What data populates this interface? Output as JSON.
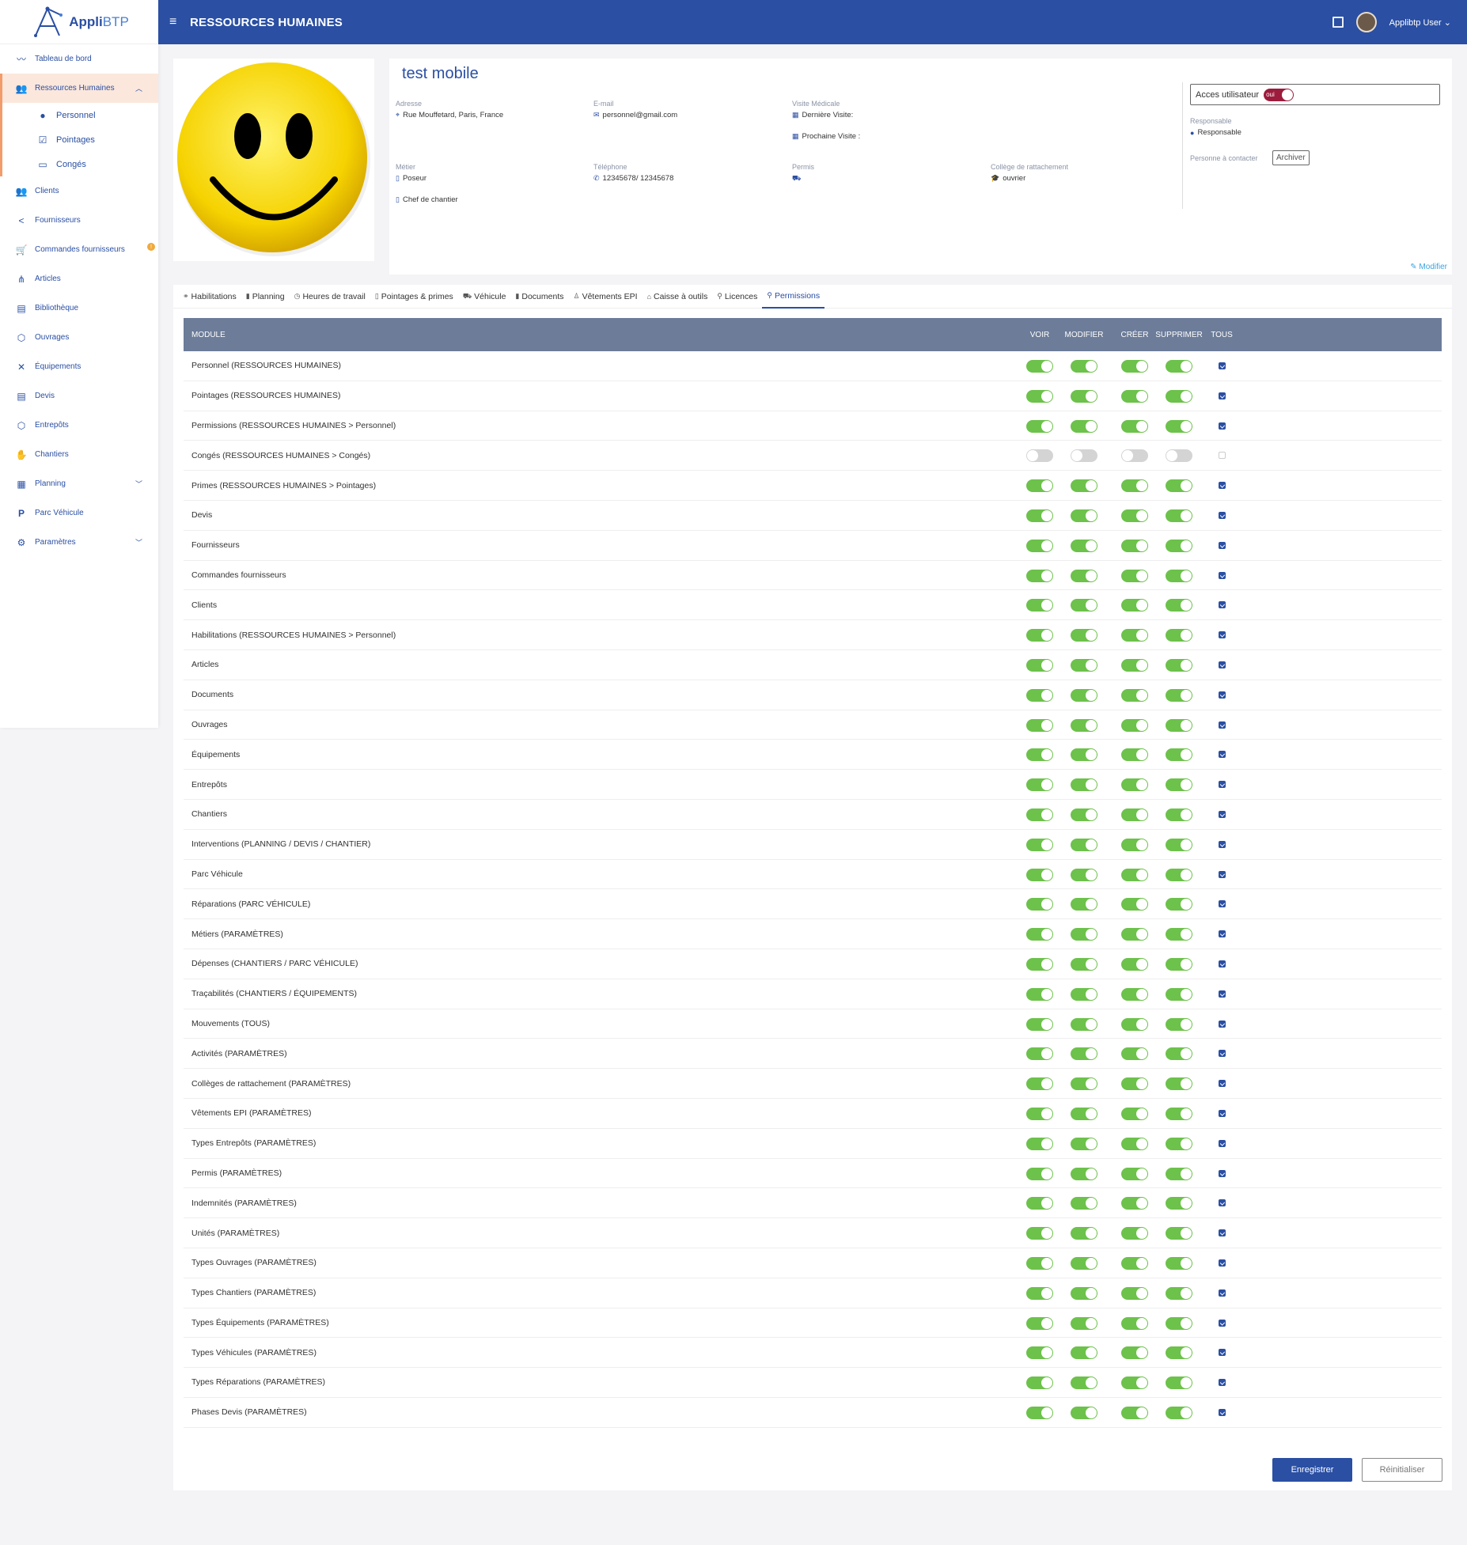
{
  "brand": {
    "name": "Appli",
    "name_suffix": "BTP"
  },
  "topbar": {
    "title": "RESSOURCES HUMAINES",
    "user": "Applibtp User"
  },
  "sidebar": {
    "items": [
      {
        "label": "Tableau de bord",
        "icon": "chart-line-icon"
      },
      {
        "label": "Ressources Humaines",
        "icon": "users-icon",
        "active": true
      },
      {
        "label": "Personnel",
        "icon": "person-icon"
      },
      {
        "label": "Pointages",
        "icon": "clipboard-check-icon"
      },
      {
        "label": "Congés",
        "icon": "id-card-icon"
      },
      {
        "label": "Clients",
        "icon": "users-icon"
      },
      {
        "label": "Fournisseurs",
        "icon": "share-icon"
      },
      {
        "label": "Commandes fournisseurs",
        "icon": "cart-icon"
      },
      {
        "label": "Articles",
        "icon": "sitemap-icon"
      },
      {
        "label": "Bibliothèque",
        "icon": "book-icon"
      },
      {
        "label": "Ouvrages",
        "icon": "cube-icon"
      },
      {
        "label": "Équipements",
        "icon": "tools-icon"
      },
      {
        "label": "Devis",
        "icon": "document-icon"
      },
      {
        "label": "Entrepôts",
        "icon": "box-icon"
      },
      {
        "label": "Chantiers",
        "icon": "handshake-icon"
      },
      {
        "label": "Planning",
        "icon": "calendar-icon"
      },
      {
        "label": "Parc Véhicule",
        "icon": "parking-icon"
      },
      {
        "label": "Paramètres",
        "icon": "gear-icon"
      }
    ],
    "badge": "!"
  },
  "profile": {
    "name": "test mobile",
    "address_label": "Adresse",
    "address": "Rue Mouffetard, Paris, France",
    "email_label": "E-mail",
    "email": "personnel@gmail.com",
    "visite_label": "Visite Médicale",
    "derniere_visite": "Dernière Visite:",
    "prochaine_visite": "Prochaine Visite :",
    "metier_label": "Métier",
    "metier": "Poseur",
    "metier2": "Chef de chantier",
    "telephone_label": "Téléphone",
    "telephone": "12345678/ 12345678",
    "permis_label": "Permis",
    "college_label": "Collège de rattachement",
    "college": "ouvrier",
    "access_label": "Acces utilisateur",
    "access_value": "oui",
    "responsable_label": "Responsable",
    "responsable": "Responsable",
    "contact_label": "Personne à contacter",
    "archiver": "Archiver",
    "modifier": "Modifier"
  },
  "tabs": [
    {
      "label": "Habilitations",
      "icon": "link-icon"
    },
    {
      "label": "Planning",
      "icon": "document-icon"
    },
    {
      "label": "Heures de travail",
      "icon": "clock-icon"
    },
    {
      "label": "Pointages & primes",
      "icon": "document-icon"
    },
    {
      "label": "Véhicule",
      "icon": "car-icon"
    },
    {
      "label": "Documents",
      "icon": "document-icon"
    },
    {
      "label": "Vêtements EPI",
      "icon": "person-icon"
    },
    {
      "label": "Caisse à outils",
      "icon": "toolbox-icon"
    },
    {
      "label": "Licences",
      "icon": "person-key-icon"
    },
    {
      "label": "Permissions",
      "icon": "person-key-icon",
      "active": true
    }
  ],
  "table": {
    "headers": {
      "module": "MODULE",
      "voir": "VOIR",
      "modifier": "MODIFIER",
      "creer": "CRÉER",
      "supprimer": "SUPPRIMER",
      "tous": "TOUS"
    },
    "rows": [
      {
        "module": "Personnel (RESSOURCES HUMAINES)",
        "on": true
      },
      {
        "module": "Pointages (RESSOURCES HUMAINES)",
        "on": true
      },
      {
        "module": "Permissions (RESSOURCES HUMAINES > Personnel)",
        "on": true
      },
      {
        "module": "Congés (RESSOURCES HUMAINES > Congés)",
        "on": false
      },
      {
        "module": "Primes (RESSOURCES HUMAINES > Pointages)",
        "on": true
      },
      {
        "module": "Devis",
        "on": true
      },
      {
        "module": "Fournisseurs",
        "on": true
      },
      {
        "module": "Commandes fournisseurs",
        "on": true
      },
      {
        "module": "Clients",
        "on": true
      },
      {
        "module": "Habilitations (RESSOURCES HUMAINES > Personnel)",
        "on": true
      },
      {
        "module": "Articles",
        "on": true
      },
      {
        "module": "Documents",
        "on": true
      },
      {
        "module": "Ouvrages",
        "on": true
      },
      {
        "module": "Équipements",
        "on": true
      },
      {
        "module": "Entrepôts",
        "on": true
      },
      {
        "module": "Chantiers",
        "on": true
      },
      {
        "module": "Interventions (PLANNING / DEVIS / CHANTIER)",
        "on": true
      },
      {
        "module": "Parc Véhicule",
        "on": true
      },
      {
        "module": "Réparations (PARC VÉHICULE)",
        "on": true
      },
      {
        "module": "Métiers (PARAMÈTRES)",
        "on": true
      },
      {
        "module": "Dépenses (CHANTIERS / PARC VÉHICULE)",
        "on": true
      },
      {
        "module": "Traçabilités (CHANTIERS / ÉQUIPEMENTS)",
        "on": true
      },
      {
        "module": "Mouvements (TOUS)",
        "on": true
      },
      {
        "module": "Activités (PARAMÈTRES)",
        "on": true
      },
      {
        "module": "Collèges de rattachement (PARAMÈTRES)",
        "on": true
      },
      {
        "module": "Vêtements EPI (PARAMÈTRES)",
        "on": true
      },
      {
        "module": "Types Entrepôts (PARAMÈTRES)",
        "on": true
      },
      {
        "module": "Permis (PARAMÈTRES)",
        "on": true
      },
      {
        "module": "Indemnités (PARAMÈTRES)",
        "on": true
      },
      {
        "module": "Unités (PARAMÈTRES)",
        "on": true
      },
      {
        "module": "Types Ouvrages (PARAMÈTRES)",
        "on": true
      },
      {
        "module": "Types Chantiers (PARAMÈTRES)",
        "on": true
      },
      {
        "module": "Types Équipements (PARAMÈTRES)",
        "on": true
      },
      {
        "module": "Types Véhicules (PARAMÈTRES)",
        "on": true
      },
      {
        "module": "Types Réparations (PARAMÈTRES)",
        "on": true
      },
      {
        "module": "Phases Devis (PARAMÈTRES)",
        "on": true
      }
    ]
  },
  "actions": {
    "save": "Enregistrer",
    "reset": "Réinitialiser"
  },
  "colors": {
    "primary": "#2a4fa3",
    "toggle_on": "#6cc24a",
    "toggle_off": "#d4d4d4",
    "active_nav": "#fbe7dc",
    "access_toggle": "#9d1b3c"
  }
}
